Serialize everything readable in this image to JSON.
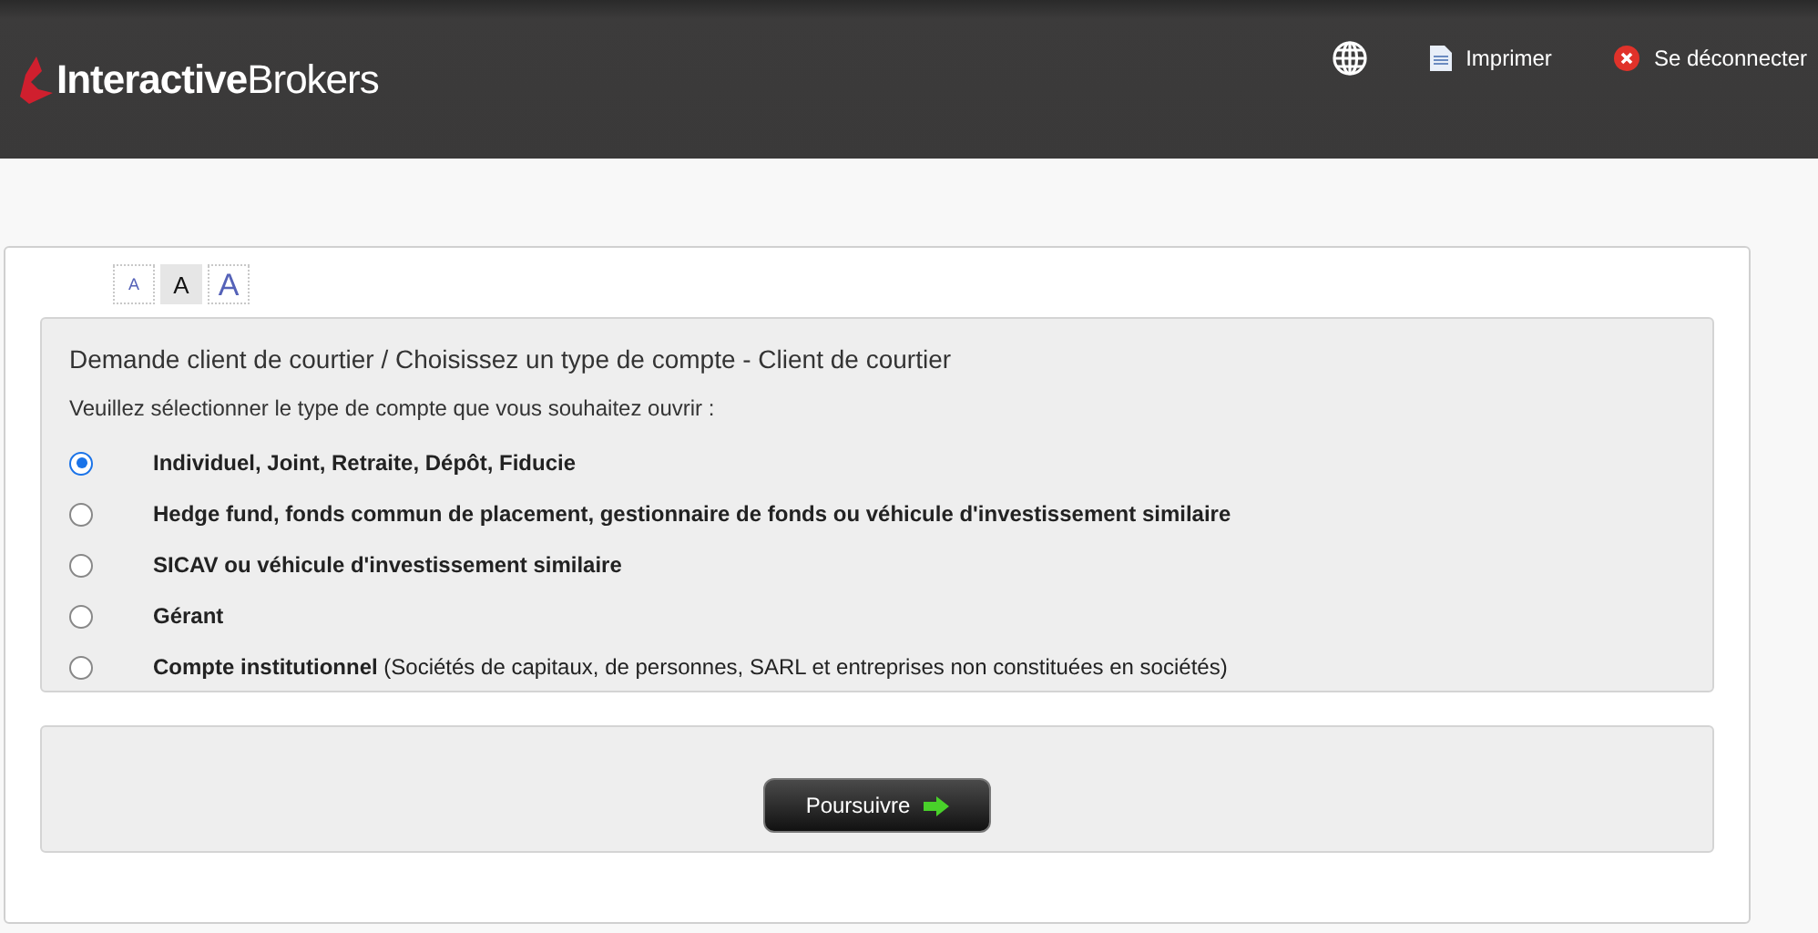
{
  "header": {
    "logo": "**Interactive**Brokers",
    "actions": [
      {
        "kind": "globe"
      },
      {
        "kind": "print",
        "label": "Imprimer"
      },
      {
        "kind": "logout",
        "label": "Se déconnecter"
      }
    ]
  },
  "font_sizes": [
    {
      "label": "A",
      "selected": false
    },
    {
      "label": "A",
      "selected": true
    },
    {
      "label": "A",
      "selected": false
    }
  ],
  "form": {
    "title": "Demande client de courtier / Choisissez un type de compte - Client de courtier",
    "prompt": "Veuillez sélectionner le type de compte que vous souhaitez ouvrir :",
    "options": [
      {
        "label": "**Individuel, Joint, Retraite, Dépôt, Fiducie**",
        "selected": true
      },
      {
        "label": "**Hedge fund, fonds commun de placement, gestionnaire de fonds ou véhicule d'investissement similaire**",
        "selected": false
      },
      {
        "label": "**SICAV ou véhicule d'investissement similaire**",
        "selected": false
      },
      {
        "label": "**Gérant**",
        "selected": false
      },
      {
        "label": "**Compte institutionnel** (Sociétés de capitaux, de personnes, SARL et entreprises non constituées en sociétés)",
        "selected": false
      }
    ]
  },
  "continue_button": "Poursuivre"
}
